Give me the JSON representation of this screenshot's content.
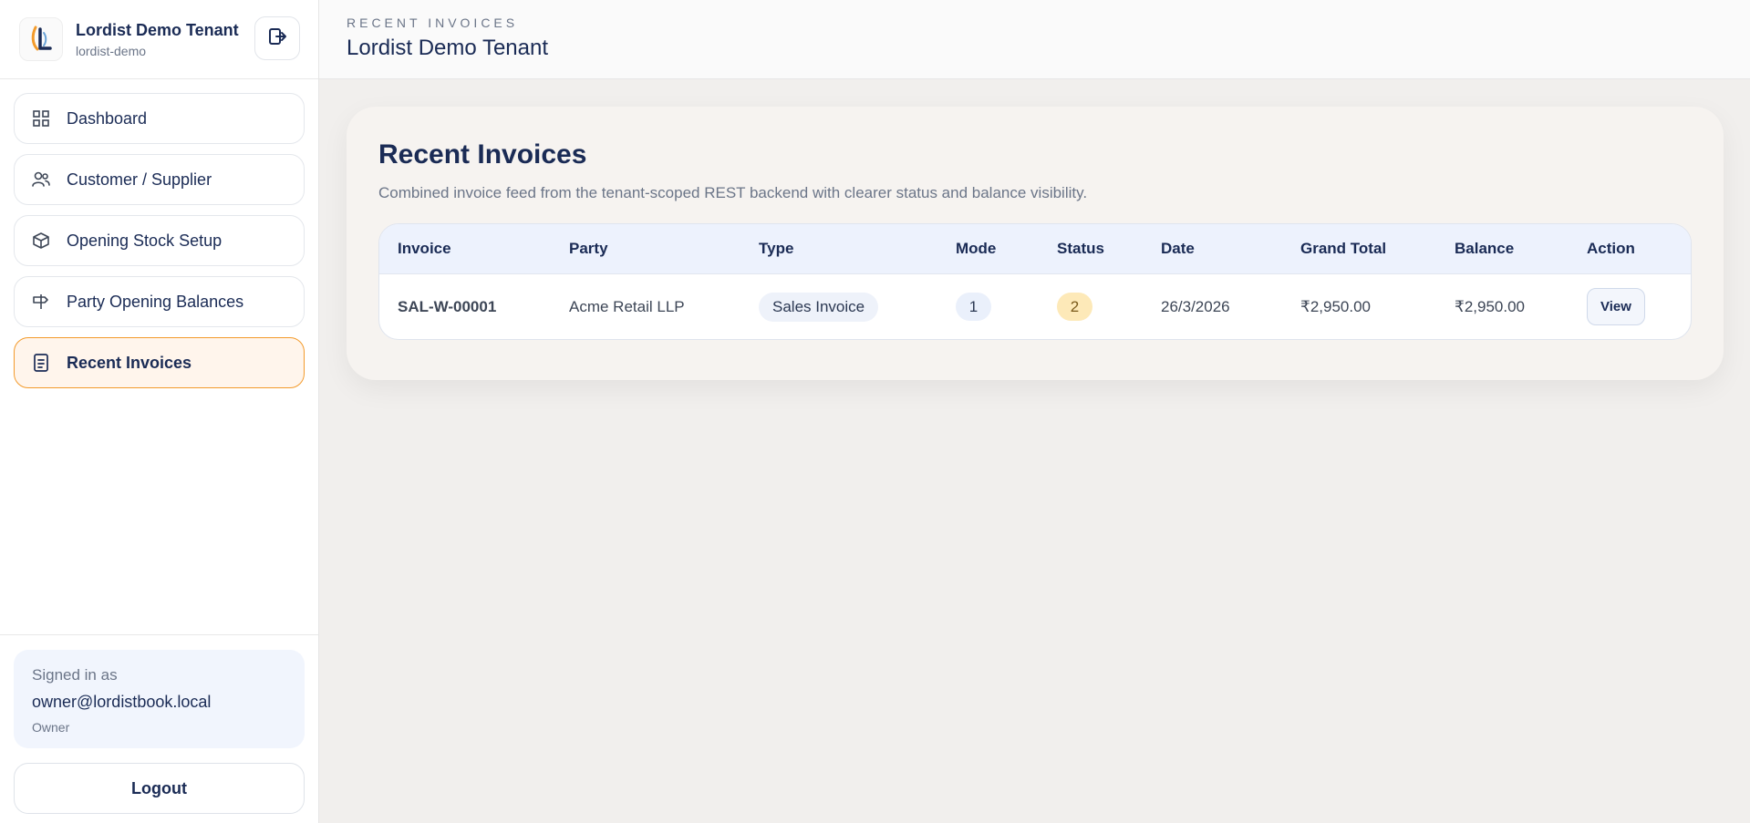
{
  "brand": {
    "name": "Lordist Demo Tenant",
    "slug": "lordist-demo",
    "exit_icon": "exit-icon",
    "logo_icon": "lordist-logo"
  },
  "nav": {
    "items": [
      {
        "label": "Dashboard",
        "icon": "grid-icon"
      },
      {
        "label": "Customer / Supplier",
        "icon": "users-icon"
      },
      {
        "label": "Opening Stock Setup",
        "icon": "box-icon"
      },
      {
        "label": "Party Opening Balances",
        "icon": "signpost-icon"
      },
      {
        "label": "Recent Invoices",
        "icon": "receipt-icon",
        "active": true
      }
    ]
  },
  "user": {
    "signed_label": "Signed in as",
    "email": "owner@lordistbook.local",
    "role": "Owner",
    "logout_label": "Logout"
  },
  "header": {
    "eyebrow": "RECENT INVOICES",
    "title": "Lordist Demo Tenant"
  },
  "panel": {
    "title": "Recent Invoices",
    "subtitle": "Combined invoice feed from the tenant-scoped REST backend with clearer status and balance visibility.",
    "columns": [
      "Invoice",
      "Party",
      "Type",
      "Mode",
      "Status",
      "Date",
      "Grand Total",
      "Balance",
      "Action"
    ],
    "rows": [
      {
        "invoice": "SAL-W-00001",
        "party": "Acme Retail LLP",
        "type": "Sales Invoice",
        "mode": "1",
        "status": "2",
        "date": "26/3/2026",
        "grand_total": "₹2,950.00",
        "balance": "₹2,950.00",
        "action": "View"
      }
    ]
  },
  "colors": {
    "accent": "#f39b2c",
    "navy": "#1a2b55",
    "status_badge": "#fde9b8"
  }
}
